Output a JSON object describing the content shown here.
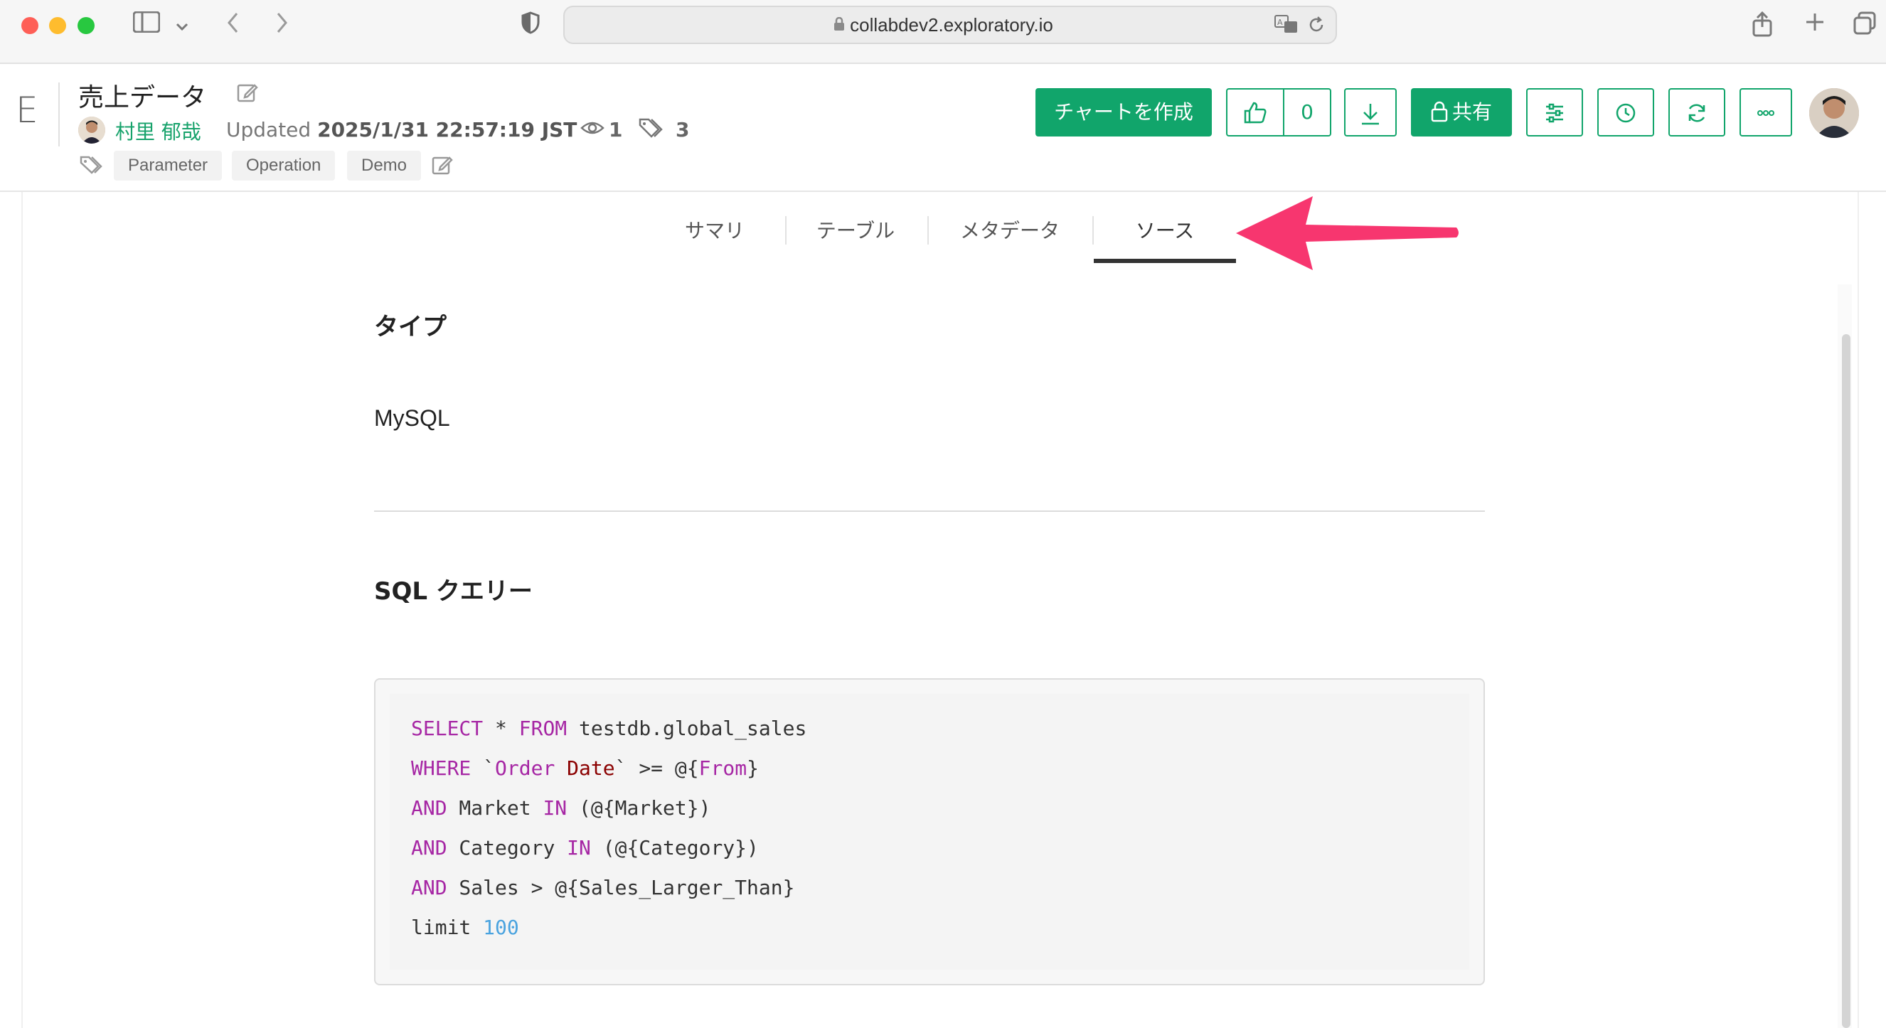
{
  "browser": {
    "url": "collabdev2.exploratory.io"
  },
  "header": {
    "logo": "E",
    "title": "売上データ",
    "author": "村里 郁哉",
    "updated_label": "Updated",
    "updated_value": "2025/1/31 22:57:19 JST",
    "views": "1",
    "tag_count": "3",
    "tags": [
      "Parameter",
      "Operation",
      "Demo"
    ],
    "create_chart_label": "チャートを作成",
    "like_count": "0",
    "share_label": "共有"
  },
  "tabs": [
    {
      "label": "サマリ"
    },
    {
      "label": "テーブル"
    },
    {
      "label": "メタデータ"
    },
    {
      "label": "ソース",
      "active": true
    }
  ],
  "main": {
    "type_heading": "タイプ",
    "type_value": "MySQL",
    "sql_heading": "SQL クエリー",
    "sql_lines": [
      "SELECT * FROM testdb.global_sales",
      "WHERE `Order Date` >= @{From}",
      "AND Market IN (@{Market})",
      "AND Category IN (@{Category})",
      "AND Sales > @{Sales_Larger_Than}",
      "limit 100"
    ]
  },
  "colors": {
    "accent": "#11a56b",
    "annotation_arrow": "#f7366f",
    "keyword": "#a626a4",
    "string": "#8b0000",
    "number": "#4aa3df"
  }
}
